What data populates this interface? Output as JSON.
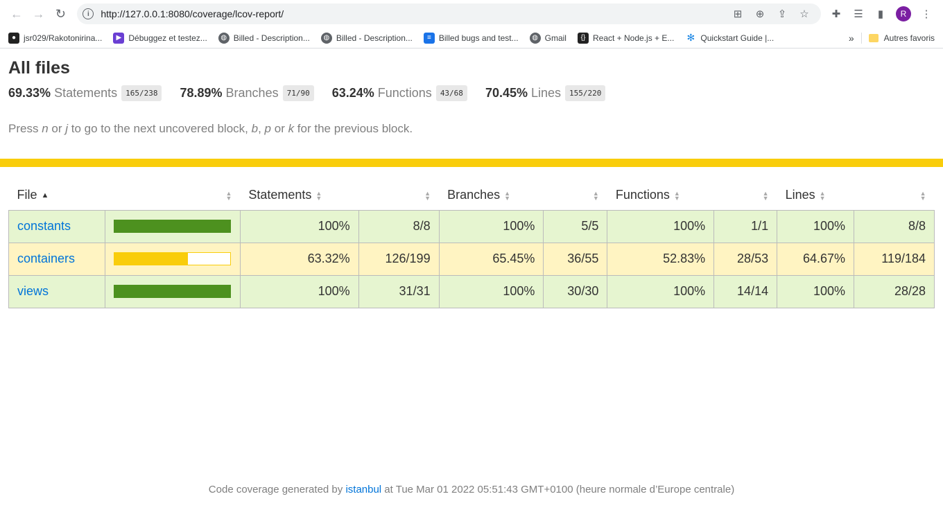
{
  "browser": {
    "url": "http://127.0.0.1:8080/coverage/lcov-report/",
    "avatar_letter": "R",
    "bookmarks": [
      {
        "label": "jsr029/Rakotonirina...",
        "icon": "github-icon",
        "color": "#222222"
      },
      {
        "label": "Débuggez et testez...",
        "icon": "openclassrooms-icon",
        "color": "#6a3fd3"
      },
      {
        "label": "Billed - Description...",
        "icon": "globe-icon",
        "color": "#5f6368"
      },
      {
        "label": "Billed - Description...",
        "icon": "globe-icon",
        "color": "#5f6368"
      },
      {
        "label": "Billed bugs and test...",
        "icon": "doc-icon",
        "color": "#1a73e8"
      },
      {
        "label": "Gmail",
        "icon": "globe-icon",
        "color": "#5f6368"
      },
      {
        "label": "React + Node.js + E...",
        "icon": "code-icon",
        "color": "#222222"
      },
      {
        "label": "Quickstart Guide |...",
        "icon": "snowflake-icon",
        "color": "#1e88e5"
      }
    ],
    "more_label": "»",
    "other_bookmarks": "Autres favoris"
  },
  "report": {
    "title": "All files",
    "summary": [
      {
        "pct": "69.33%",
        "label": "Statements",
        "fraction": "165/238"
      },
      {
        "pct": "78.89%",
        "label": "Branches",
        "fraction": "71/90"
      },
      {
        "pct": "63.24%",
        "label": "Functions",
        "fraction": "43/68"
      },
      {
        "pct": "70.45%",
        "label": "Lines",
        "fraction": "155/220"
      }
    ],
    "hint": {
      "p1": "Press ",
      "k1": "n",
      "p2": " or ",
      "k2": "j",
      "p3": " to go to the next uncovered block, ",
      "k3": "b",
      "p4": ", ",
      "k4": "p",
      "p5": " or ",
      "k5": "k",
      "p6": " for the previous block."
    },
    "columns": {
      "file": "File",
      "statements": "Statements",
      "branches": "Branches",
      "functions": "Functions",
      "lines": "Lines"
    },
    "rows": [
      {
        "file": "constants",
        "level": "high",
        "coverage": 1.0,
        "stmt_pct": "100%",
        "stmt_frac": "8/8",
        "br_pct": "100%",
        "br_frac": "5/5",
        "fn_pct": "100%",
        "fn_frac": "1/1",
        "ln_pct": "100%",
        "ln_frac": "8/8"
      },
      {
        "file": "containers",
        "level": "medium",
        "coverage": 0.6332,
        "stmt_pct": "63.32%",
        "stmt_frac": "126/199",
        "br_pct": "65.45%",
        "br_frac": "36/55",
        "fn_pct": "52.83%",
        "fn_frac": "28/53",
        "ln_pct": "64.67%",
        "ln_frac": "119/184"
      },
      {
        "file": "views",
        "level": "high",
        "coverage": 1.0,
        "stmt_pct": "100%",
        "stmt_frac": "31/31",
        "br_pct": "100%",
        "br_frac": "30/30",
        "fn_pct": "100%",
        "fn_frac": "14/14",
        "ln_pct": "100%",
        "ln_frac": "28/28"
      }
    ],
    "footer": {
      "prefix": "Code coverage generated by ",
      "link": "istanbul",
      "suffix": " at Tue Mar 01 2022 05:51:43 GMT+0100 (heure normale d’Europe centrale)"
    },
    "colors": {
      "high": "#e6f5d0",
      "medium": "#fff4c2",
      "bar_high": "#4d911f",
      "bar_medium": "#f9cd0b"
    }
  }
}
